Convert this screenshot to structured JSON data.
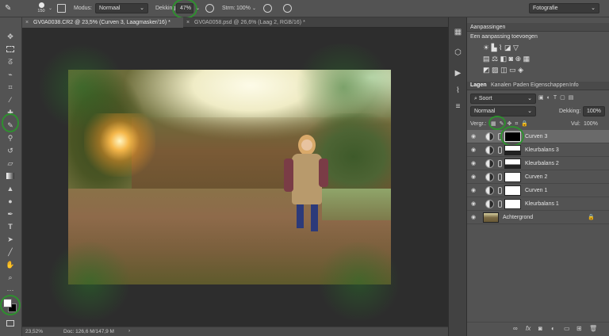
{
  "options_bar": {
    "brush_size": "150",
    "mode_label": "Modus:",
    "mode_value": "Normaal",
    "opacity_label": "Dekking:",
    "opacity_value": "47%",
    "flow_label": "Strm:",
    "flow_value": "100%",
    "workspace": "Fotografie"
  },
  "doc_tabs": [
    {
      "title": "GV0A0038.CR2 @ 23,5% (Curven 3, Laagmasker/16) *",
      "active": true
    },
    {
      "title": "GV0A0058.psd @ 26,6% (Laag 2, RGB/16) *",
      "active": false
    }
  ],
  "status_bar": {
    "zoom": "23,52%",
    "doc": "Doc: 126,6 M/147,9 M"
  },
  "adjustments": {
    "title": "Aanpassingen",
    "subtitle": "Een aanpassing toevoegen"
  },
  "layers_panel": {
    "tabs": [
      "Lagen",
      "Kanalen",
      "Paden",
      "Eigenschappen",
      "Info"
    ],
    "filter": "Soort",
    "blend_mode": "Normaal",
    "opacity_label": "Dekking:",
    "opacity_value": "100%",
    "lock_label": "Vergr.:",
    "fill_label": "Vul:",
    "fill_value": "100%",
    "layers": [
      {
        "name": "Curven 3",
        "mask": "black",
        "selected": true
      },
      {
        "name": "Kleurbalans 3",
        "mask": "white-dark",
        "selected": false
      },
      {
        "name": "Kleurbalans 2",
        "mask": "white-dark",
        "selected": false
      },
      {
        "name": "Curven 2",
        "mask": "white",
        "selected": false
      },
      {
        "name": "Curven 1",
        "mask": "white",
        "selected": false
      },
      {
        "name": "Kleurbalans 1",
        "mask": "white",
        "selected": false
      },
      {
        "name": "Achtergrond",
        "mask": "photo",
        "selected": false
      }
    ]
  },
  "colors": {
    "foreground": "#ffffff",
    "background": "#000000",
    "highlight": "#2f8f2f"
  }
}
